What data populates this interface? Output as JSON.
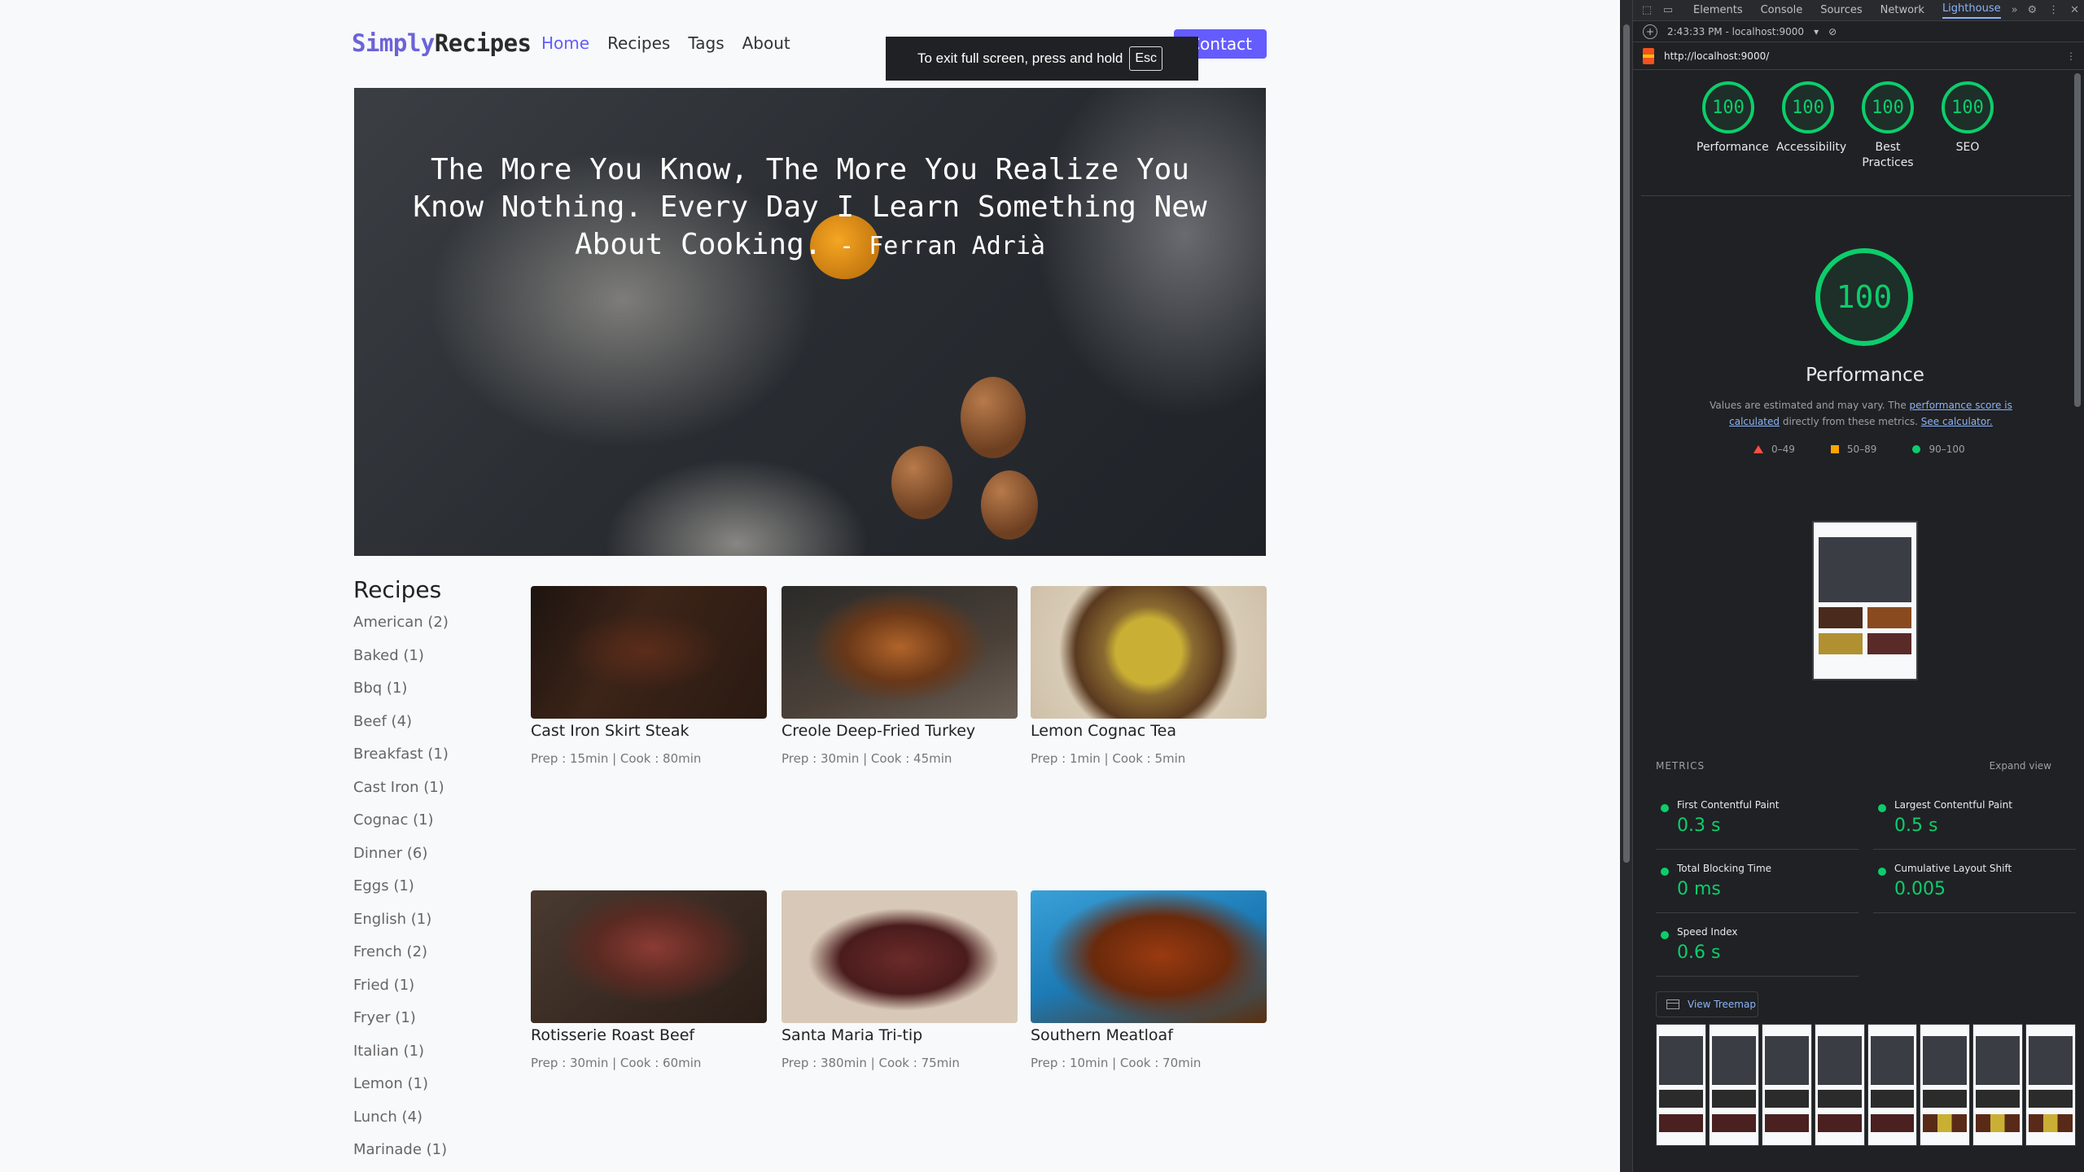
{
  "site": {
    "logo_a": "Simply",
    "logo_b": "Recipes",
    "nav": [
      "Home",
      "Recipes",
      "Tags",
      "About"
    ],
    "contact": "Contact",
    "hero_quote": "The More You Know, The More You Realize You Know Nothing. Every Day I Learn Something New About Cooking.",
    "hero_author": "- Ferran Adrià",
    "sidebar_title": "Recipes",
    "tags": [
      "American (2)",
      "Baked (1)",
      "Bbq (1)",
      "Beef (4)",
      "Breakfast (1)",
      "Cast Iron (1)",
      "Cognac (1)",
      "Dinner (6)",
      "Eggs (1)",
      "English (1)",
      "French (2)",
      "Fried (1)",
      "Fryer (1)",
      "Italian (1)",
      "Lemon (1)",
      "Lunch (4)",
      "Marinade (1)"
    ],
    "recipes": [
      {
        "title": "Cast Iron Skirt Steak",
        "meta": "Prep : 15min | Cook : 80min"
      },
      {
        "title": "Creole Deep-Fried Turkey",
        "meta": "Prep : 30min | Cook : 45min"
      },
      {
        "title": "Lemon Cognac Tea",
        "meta": "Prep : 1min | Cook : 5min"
      },
      {
        "title": "Rotisserie Roast Beef",
        "meta": "Prep : 30min | Cook : 60min"
      },
      {
        "title": "Santa Maria Tri-tip",
        "meta": "Prep : 380min | Cook : 75min"
      },
      {
        "title": "Southern Meatloaf",
        "meta": "Prep : 10min | Cook : 70min"
      }
    ]
  },
  "toast": {
    "text": "To exit full screen, press and hold",
    "key": "Esc"
  },
  "devtools": {
    "tabs": [
      "Elements",
      "Console",
      "Sources",
      "Network",
      "Lighthouse"
    ],
    "report_time": "2:43:33 PM - localhost:9000",
    "url": "http://localhost:9000/",
    "scores": [
      {
        "value": "100",
        "label": "Performance"
      },
      {
        "value": "100",
        "label": "Accessibility"
      },
      {
        "value": "100",
        "label": "Best Practices"
      },
      {
        "value": "100",
        "label": "SEO"
      }
    ],
    "main_score": "100",
    "main_title": "Performance",
    "desc_1": "Values are estimated and may vary. The ",
    "desc_link_1": "performance score is calculated",
    "desc_2": " directly from these metrics. ",
    "desc_link_2": "See calculator.",
    "legend": [
      "0–49",
      "50–89",
      "90–100"
    ],
    "metrics_title": "METRICS",
    "expand": "Expand view",
    "metrics": [
      {
        "name": "First Contentful Paint",
        "value": "0.3 s"
      },
      {
        "name": "Largest Contentful Paint",
        "value": "0.5 s"
      },
      {
        "name": "Total Blocking Time",
        "value": "0 ms"
      },
      {
        "name": "Cumulative Layout Shift",
        "value": "0.005"
      },
      {
        "name": "Speed Index",
        "value": "0.6 s"
      }
    ],
    "treemap": "View Treemap",
    "colors": {
      "pass": "#0cce6b",
      "average": "#ffa400",
      "fail": "#ff4e42",
      "accent": "#645cff"
    }
  }
}
